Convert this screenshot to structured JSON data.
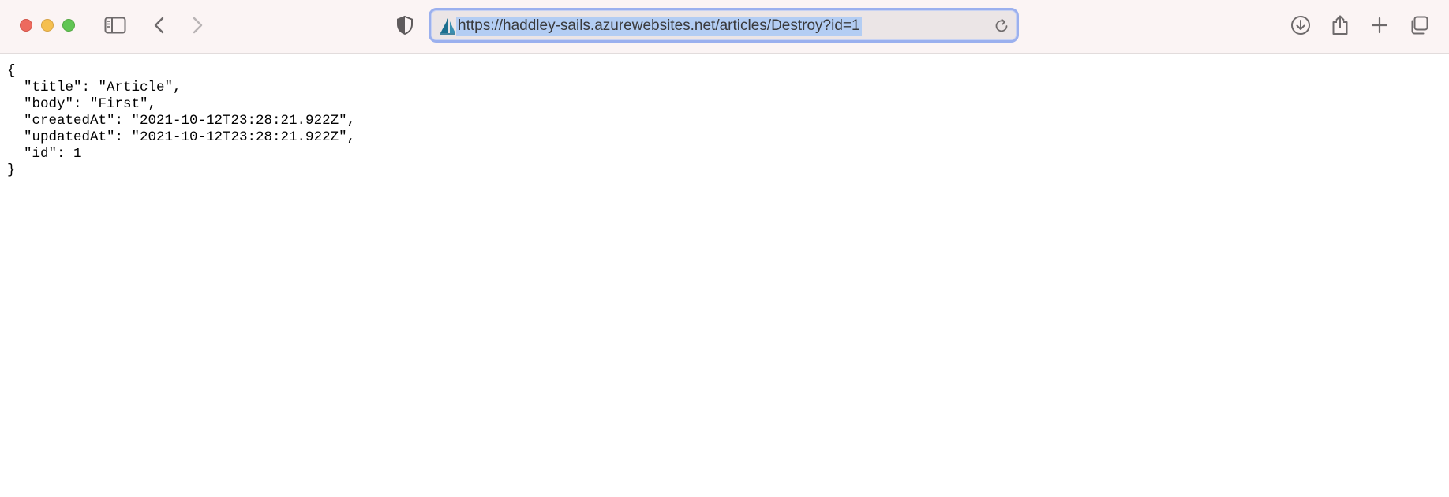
{
  "browser": {
    "url": "https://haddley-sails.azurewebsites.net/articles/Destroy?id=1",
    "colors": {
      "selection": "#b3cdf3",
      "focus_ring": "#9bb0ee",
      "toolbar_bg": "#fbf4f4"
    },
    "icons": {
      "sidebar": "sidebar-icon",
      "back": "chevron-left-icon",
      "forward": "chevron-right-icon",
      "privacy": "shield-icon",
      "site": "sails-logo-icon",
      "reload": "reload-icon",
      "downloads": "download-icon",
      "share": "share-icon",
      "new_tab": "plus-icon",
      "tab_overview": "tabs-overview-icon"
    }
  },
  "json": {
    "open": "{",
    "line1": "  \"title\": \"Article\",",
    "line2": "  \"body\": \"First\",",
    "line3": "  \"createdAt\": \"2021-10-12T23:28:21.922Z\",",
    "line4": "  \"updatedAt\": \"2021-10-12T23:28:21.922Z\",",
    "line5": "  \"id\": 1",
    "close": "}"
  }
}
